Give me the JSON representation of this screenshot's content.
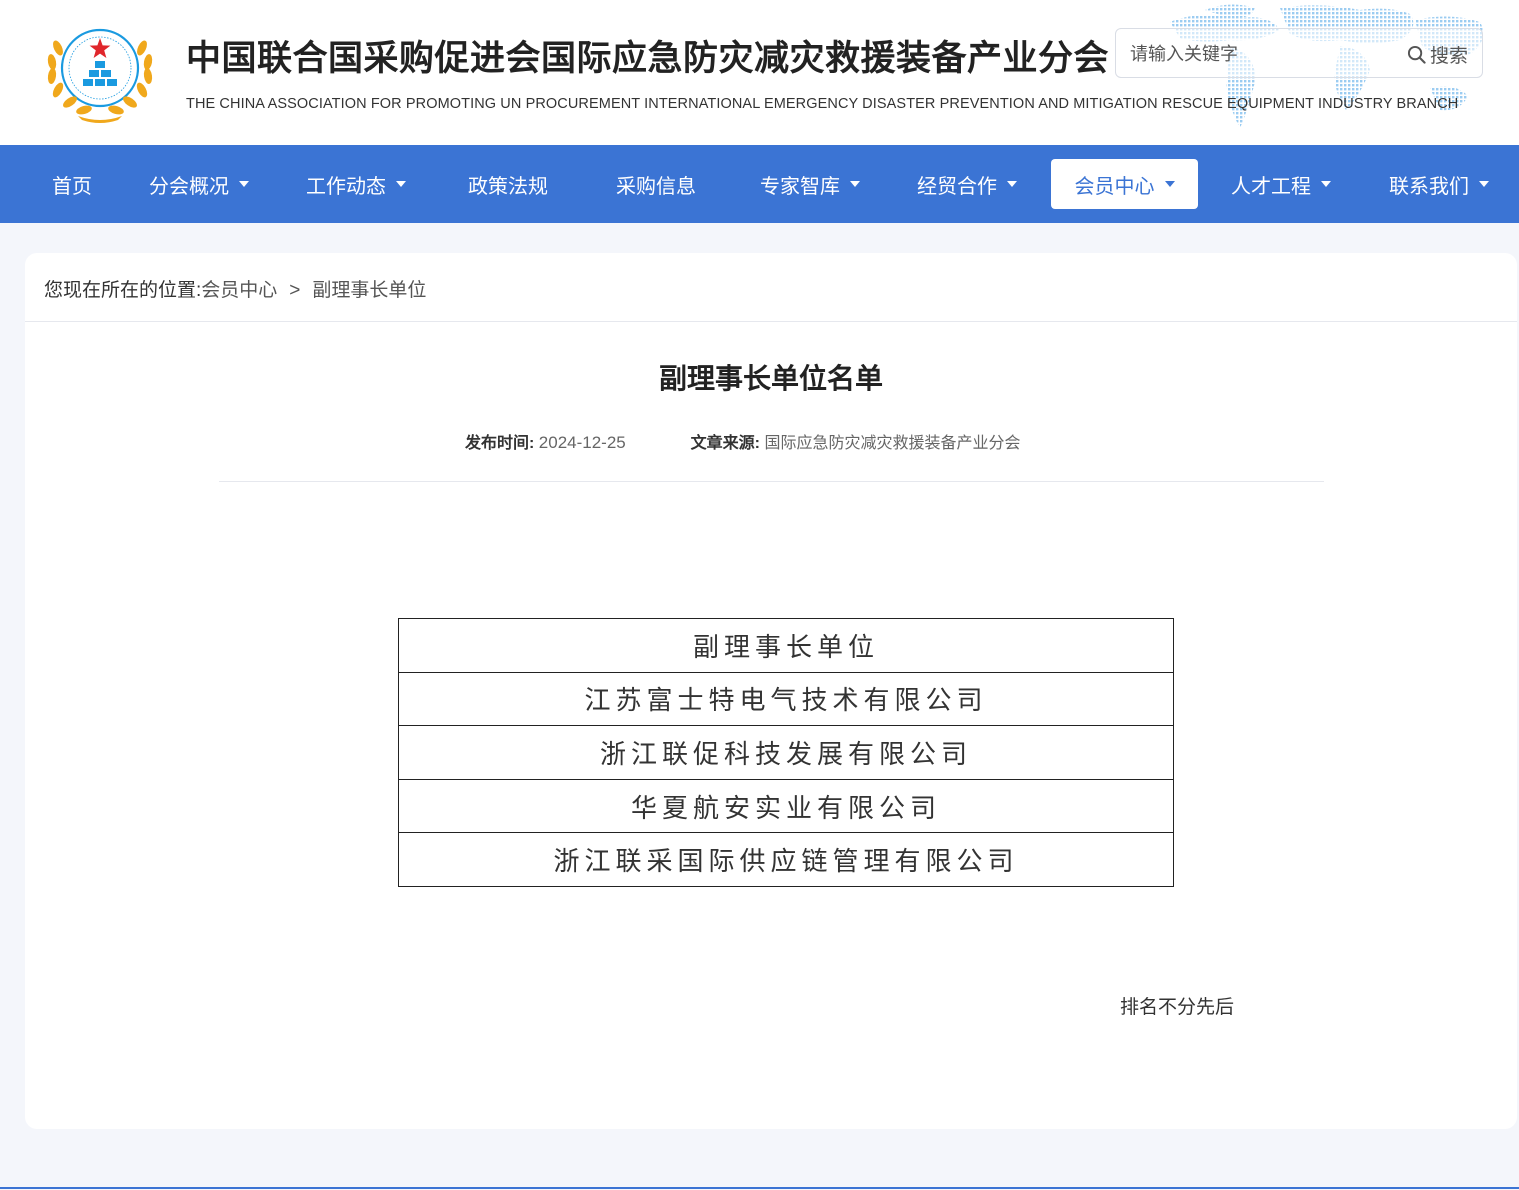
{
  "header": {
    "title": "中国联合国采购促进会国际应急防灾减灾救援装备产业分会",
    "subtitle": "THE CHINA ASSOCIATION FOR PROMOTING UN PROCUREMENT INTERNATIONAL EMERGENCY DISASTER PREVENTION AND MITIGATION RESCUE EQUIPMENT INDUSTRY BRANCH",
    "search": {
      "placeholder": "请输入关键字",
      "button_label": "搜索"
    }
  },
  "nav": {
    "items": [
      {
        "label": "首页",
        "has_dropdown": false
      },
      {
        "label": "分会概况",
        "has_dropdown": true
      },
      {
        "label": "工作动态",
        "has_dropdown": true
      },
      {
        "label": "政策法规",
        "has_dropdown": false
      },
      {
        "label": "采购信息",
        "has_dropdown": false
      },
      {
        "label": "专家智库",
        "has_dropdown": true
      },
      {
        "label": "经贸合作",
        "has_dropdown": true
      },
      {
        "label": "会员中心",
        "has_dropdown": true,
        "active": true
      },
      {
        "label": "人才工程",
        "has_dropdown": true
      },
      {
        "label": "联系我们",
        "has_dropdown": true
      }
    ]
  },
  "breadcrumb": {
    "prefix": "您现在所在的位置:",
    "items": [
      "会员中心",
      "副理事长单位"
    ],
    "separator": ">"
  },
  "article": {
    "title": "副理事长单位名单",
    "publish_label": "发布时间:",
    "publish_date": "2024-12-25",
    "source_label": "文章来源:",
    "source": "国际应急防灾减灾救援装备产业分会",
    "table": {
      "header": "副理事长单位",
      "rows": [
        "江苏富士特电气技术有限公司",
        "浙江联促科技发展有限公司",
        "华夏航安实业有限公司",
        "浙江联采国际供应链管理有限公司"
      ]
    },
    "note": "排名不分先后"
  },
  "colors": {
    "nav_bg": "#3b74d4",
    "page_bg": "#f4f6fb",
    "logo_gold": "#f0a81c",
    "logo_blue": "#1a9ae0",
    "logo_star": "#e0262b"
  },
  "icons": {
    "logo": "association-emblem",
    "search": "search-icon",
    "dropdown": "caret-down-icon"
  }
}
